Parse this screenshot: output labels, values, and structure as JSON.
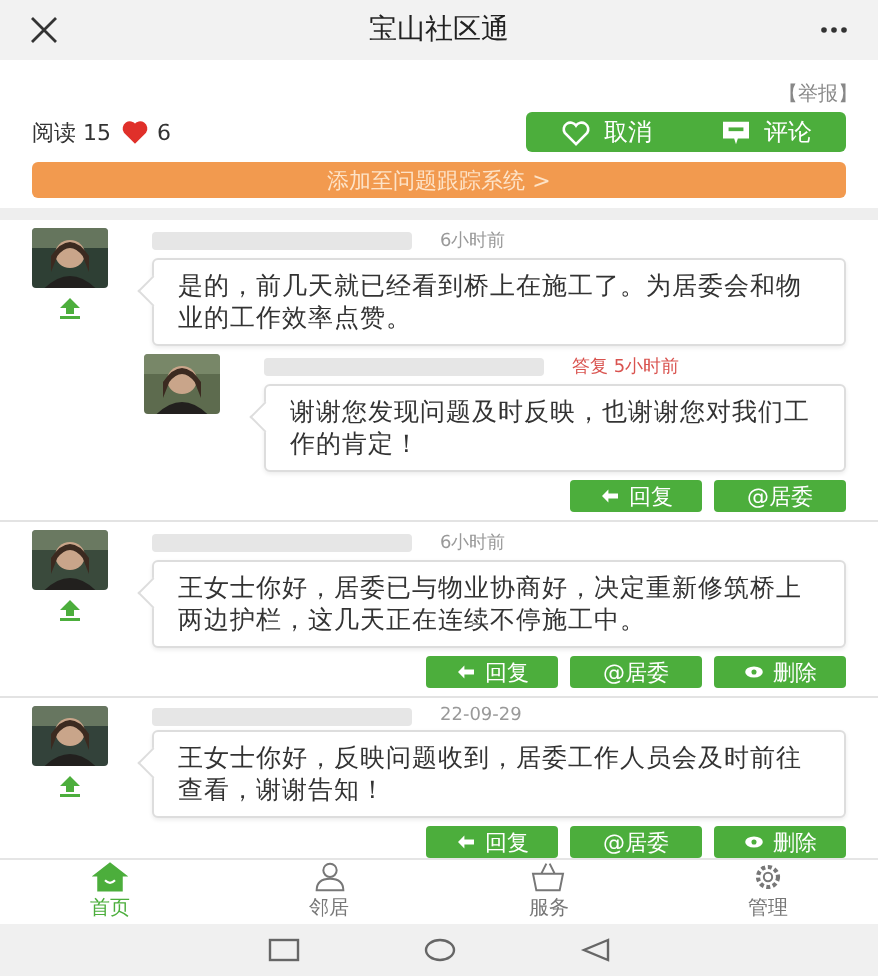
{
  "header": {
    "title": "宝山社区通"
  },
  "report": "【举报】",
  "stats": {
    "reads": "阅读 15",
    "likes": "6",
    "liked": true
  },
  "post_actions": [
    {
      "kind": "like",
      "label": "取消"
    },
    {
      "kind": "comment",
      "label": "评论"
    }
  ],
  "banner": "添加至问题跟踪系统 >",
  "comments": [
    {
      "time": "6小时前",
      "text": "是的，前几天就已经看到桥上在施工了。为居委会和物业的工作效率点赞。",
      "replies": [
        {
          "time": "答复 5小时前",
          "text": "谢谢您发现问题及时反映，也谢谢您对我们工作的肯定！"
        }
      ],
      "actions": [
        {
          "kind": "reply",
          "label": "回复"
        },
        {
          "kind": "mention",
          "label": "@居委"
        }
      ]
    },
    {
      "time": "6小时前",
      "text": "王女士你好，居委已与物业协商好，决定重新修筑桥上两边护栏，这几天正在连续不停施工中。",
      "actions": [
        {
          "kind": "reply",
          "label": "回复"
        },
        {
          "kind": "mention",
          "label": "@居委"
        },
        {
          "kind": "delete",
          "label": "删除"
        }
      ]
    },
    {
      "time": "22-09-29",
      "text": "王女士你好，反映问题收到，居委工作人员会及时前往查看，谢谢告知！",
      "actions": [
        {
          "kind": "reply",
          "label": "回复"
        },
        {
          "kind": "mention",
          "label": "@居委"
        },
        {
          "kind": "delete",
          "label": "删除"
        }
      ]
    }
  ],
  "tabs": [
    {
      "kind": "home",
      "label": "首页",
      "selected": true
    },
    {
      "kind": "neighbor",
      "label": "邻居",
      "selected": false
    },
    {
      "kind": "service",
      "label": "服务",
      "selected": false
    },
    {
      "kind": "manage",
      "label": "管理",
      "selected": false
    }
  ]
}
